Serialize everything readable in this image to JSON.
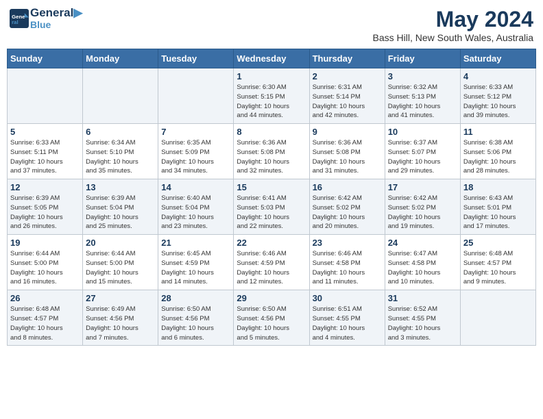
{
  "logo": {
    "line1": "General",
    "line2": "Blue"
  },
  "title": "May 2024",
  "subtitle": "Bass Hill, New South Wales, Australia",
  "weekdays": [
    "Sunday",
    "Monday",
    "Tuesday",
    "Wednesday",
    "Thursday",
    "Friday",
    "Saturday"
  ],
  "weeks": [
    [
      {
        "day": "",
        "info": ""
      },
      {
        "day": "",
        "info": ""
      },
      {
        "day": "",
        "info": ""
      },
      {
        "day": "1",
        "info": "Sunrise: 6:30 AM\nSunset: 5:15 PM\nDaylight: 10 hours\nand 44 minutes."
      },
      {
        "day": "2",
        "info": "Sunrise: 6:31 AM\nSunset: 5:14 PM\nDaylight: 10 hours\nand 42 minutes."
      },
      {
        "day": "3",
        "info": "Sunrise: 6:32 AM\nSunset: 5:13 PM\nDaylight: 10 hours\nand 41 minutes."
      },
      {
        "day": "4",
        "info": "Sunrise: 6:33 AM\nSunset: 5:12 PM\nDaylight: 10 hours\nand 39 minutes."
      }
    ],
    [
      {
        "day": "5",
        "info": "Sunrise: 6:33 AM\nSunset: 5:11 PM\nDaylight: 10 hours\nand 37 minutes."
      },
      {
        "day": "6",
        "info": "Sunrise: 6:34 AM\nSunset: 5:10 PM\nDaylight: 10 hours\nand 35 minutes."
      },
      {
        "day": "7",
        "info": "Sunrise: 6:35 AM\nSunset: 5:09 PM\nDaylight: 10 hours\nand 34 minutes."
      },
      {
        "day": "8",
        "info": "Sunrise: 6:36 AM\nSunset: 5:08 PM\nDaylight: 10 hours\nand 32 minutes."
      },
      {
        "day": "9",
        "info": "Sunrise: 6:36 AM\nSunset: 5:08 PM\nDaylight: 10 hours\nand 31 minutes."
      },
      {
        "day": "10",
        "info": "Sunrise: 6:37 AM\nSunset: 5:07 PM\nDaylight: 10 hours\nand 29 minutes."
      },
      {
        "day": "11",
        "info": "Sunrise: 6:38 AM\nSunset: 5:06 PM\nDaylight: 10 hours\nand 28 minutes."
      }
    ],
    [
      {
        "day": "12",
        "info": "Sunrise: 6:39 AM\nSunset: 5:05 PM\nDaylight: 10 hours\nand 26 minutes."
      },
      {
        "day": "13",
        "info": "Sunrise: 6:39 AM\nSunset: 5:04 PM\nDaylight: 10 hours\nand 25 minutes."
      },
      {
        "day": "14",
        "info": "Sunrise: 6:40 AM\nSunset: 5:04 PM\nDaylight: 10 hours\nand 23 minutes."
      },
      {
        "day": "15",
        "info": "Sunrise: 6:41 AM\nSunset: 5:03 PM\nDaylight: 10 hours\nand 22 minutes."
      },
      {
        "day": "16",
        "info": "Sunrise: 6:42 AM\nSunset: 5:02 PM\nDaylight: 10 hours\nand 20 minutes."
      },
      {
        "day": "17",
        "info": "Sunrise: 6:42 AM\nSunset: 5:02 PM\nDaylight: 10 hours\nand 19 minutes."
      },
      {
        "day": "18",
        "info": "Sunrise: 6:43 AM\nSunset: 5:01 PM\nDaylight: 10 hours\nand 17 minutes."
      }
    ],
    [
      {
        "day": "19",
        "info": "Sunrise: 6:44 AM\nSunset: 5:00 PM\nDaylight: 10 hours\nand 16 minutes."
      },
      {
        "day": "20",
        "info": "Sunrise: 6:44 AM\nSunset: 5:00 PM\nDaylight: 10 hours\nand 15 minutes."
      },
      {
        "day": "21",
        "info": "Sunrise: 6:45 AM\nSunset: 4:59 PM\nDaylight: 10 hours\nand 14 minutes."
      },
      {
        "day": "22",
        "info": "Sunrise: 6:46 AM\nSunset: 4:59 PM\nDaylight: 10 hours\nand 12 minutes."
      },
      {
        "day": "23",
        "info": "Sunrise: 6:46 AM\nSunset: 4:58 PM\nDaylight: 10 hours\nand 11 minutes."
      },
      {
        "day": "24",
        "info": "Sunrise: 6:47 AM\nSunset: 4:58 PM\nDaylight: 10 hours\nand 10 minutes."
      },
      {
        "day": "25",
        "info": "Sunrise: 6:48 AM\nSunset: 4:57 PM\nDaylight: 10 hours\nand 9 minutes."
      }
    ],
    [
      {
        "day": "26",
        "info": "Sunrise: 6:48 AM\nSunset: 4:57 PM\nDaylight: 10 hours\nand 8 minutes."
      },
      {
        "day": "27",
        "info": "Sunrise: 6:49 AM\nSunset: 4:56 PM\nDaylight: 10 hours\nand 7 minutes."
      },
      {
        "day": "28",
        "info": "Sunrise: 6:50 AM\nSunset: 4:56 PM\nDaylight: 10 hours\nand 6 minutes."
      },
      {
        "day": "29",
        "info": "Sunrise: 6:50 AM\nSunset: 4:56 PM\nDaylight: 10 hours\nand 5 minutes."
      },
      {
        "day": "30",
        "info": "Sunrise: 6:51 AM\nSunset: 4:55 PM\nDaylight: 10 hours\nand 4 minutes."
      },
      {
        "day": "31",
        "info": "Sunrise: 6:52 AM\nSunset: 4:55 PM\nDaylight: 10 hours\nand 3 minutes."
      },
      {
        "day": "",
        "info": ""
      }
    ]
  ]
}
